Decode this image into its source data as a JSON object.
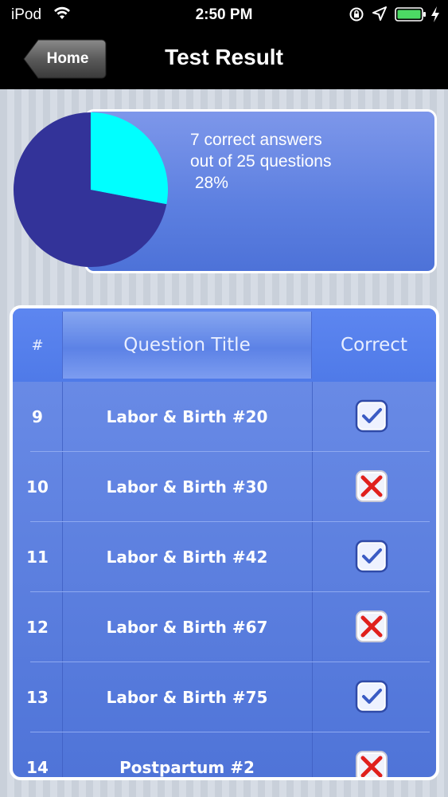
{
  "status_bar": {
    "carrier": "iPod",
    "time": "2:50 PM",
    "icons": [
      "wifi-icon",
      "orientation-lock-icon",
      "location-arrow-icon",
      "battery-icon",
      "charging-bolt-icon"
    ]
  },
  "nav": {
    "back_label": "Home",
    "title": "Test Result"
  },
  "summary": {
    "line1": "7 correct answers",
    "line2": "out of 25 questions",
    "line3": " 28%",
    "correct_count": 7,
    "total_questions": 25,
    "percent": 28
  },
  "colors": {
    "pie_correct": "#00ffff",
    "pie_incorrect": "#333399",
    "card_blue": "#5c7fe0",
    "check_blue": "#3a5bc4",
    "cross_red": "#e0201c"
  },
  "table": {
    "headers": {
      "num": "#",
      "title": "Question Title",
      "correct": "Correct"
    },
    "rows": [
      {
        "num": "9",
        "title": "Labor & Birth #20",
        "correct": true
      },
      {
        "num": "10",
        "title": "Labor & Birth #30",
        "correct": false
      },
      {
        "num": "11",
        "title": "Labor & Birth #42",
        "correct": true
      },
      {
        "num": "12",
        "title": "Labor & Birth #67",
        "correct": false
      },
      {
        "num": "13",
        "title": "Labor & Birth #75",
        "correct": true
      },
      {
        "num": "14",
        "title": "Postpartum #2",
        "correct": false
      }
    ]
  }
}
